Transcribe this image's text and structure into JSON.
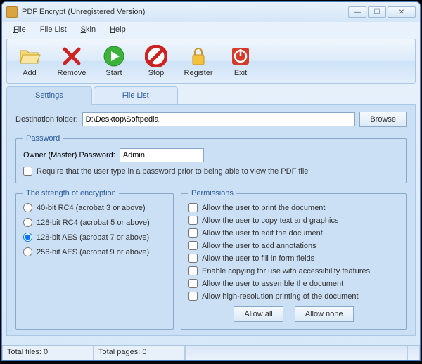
{
  "window": {
    "title": "PDF Encrypt (Unregistered Version)"
  },
  "menu": {
    "file": "File",
    "file_list": "File List",
    "skin": "Skin",
    "help": "Help"
  },
  "toolbar": {
    "add": "Add",
    "remove": "Remove",
    "start": "Start",
    "stop": "Stop",
    "register": "Register",
    "exit": "Exit"
  },
  "tabs": {
    "settings": "Settings",
    "file_list": "File List"
  },
  "destination": {
    "label": "Destination folder:",
    "value": "D:\\Desktop\\Softpedia",
    "browse": "Browse"
  },
  "password": {
    "legend": "Password",
    "owner_label": "Owner (Master) Password:",
    "owner_value": "Admin",
    "require_label": "Require that the user type in a password prior to being able to view the PDF file"
  },
  "encryption": {
    "legend": "The strength of encryption",
    "options": [
      "40-bit RC4 (acrobat 3 or above)",
      "128-bit RC4 (acrobat 5 or above)",
      "128-bit AES (acrobat 7 or above)",
      "256-bit AES (acrobat 9 or above)"
    ]
  },
  "permissions": {
    "legend": "Permissions",
    "options": [
      "Allow the user to print the document",
      "Allow the user to copy text and graphics",
      "Allow the user to edit the document",
      "Allow the user to add annotations",
      "Allow the user to fill in form fields",
      "Enable copying for use with accessibility features",
      "Allow the user to assemble the document",
      "Allow high-resolution printing of the document"
    ],
    "allow_all": "Allow all",
    "allow_none": "Allow none"
  },
  "status": {
    "total_files": "Total files: 0",
    "total_pages": "Total pages: 0"
  }
}
